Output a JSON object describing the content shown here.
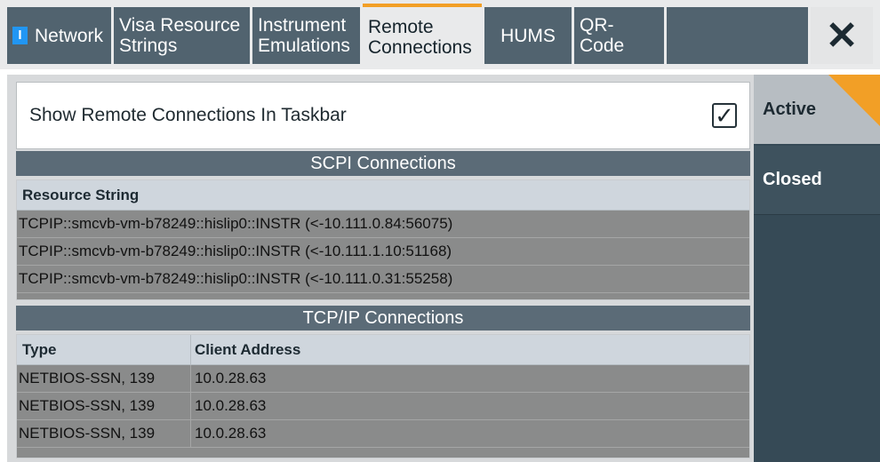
{
  "tabs": [
    {
      "label": "Network",
      "icon": "info-icon"
    },
    {
      "label": "Visa Resource\nStrings"
    },
    {
      "label": "Instrument\nEmulations"
    },
    {
      "label": "Remote\nConnections",
      "active": true
    },
    {
      "label": "HUMS"
    },
    {
      "label": "QR-\nCode"
    }
  ],
  "close_icon": "close-icon",
  "taskbar": {
    "label": "Show Remote Connections In Taskbar",
    "checked": true,
    "check_glyph": "✓"
  },
  "scpi": {
    "title": "SCPI Connections",
    "header": "Resource String",
    "rows": [
      "TCPIP::smcvb-vm-b78249::hislip0::INSTR (<-10.111.0.84:56075)",
      "TCPIP::smcvb-vm-b78249::hislip0::INSTR (<-10.111.1.10:51168)",
      "TCPIP::smcvb-vm-b78249::hislip0::INSTR (<-10.111.0.31:55258)"
    ]
  },
  "tcpip": {
    "title": "TCP/IP Connections",
    "headers": [
      "Type",
      "Client Address"
    ],
    "rows": [
      [
        "NETBIOS-SSN, 139",
        "10.0.28.63"
      ],
      [
        "NETBIOS-SSN, 139",
        "10.0.28.63"
      ],
      [
        "NETBIOS-SSN, 139",
        "10.0.28.63"
      ]
    ]
  },
  "side": {
    "active_label": "Active",
    "closed_label": "Closed"
  },
  "colors": {
    "accent": "#f29f26",
    "tab_bg": "#51636f",
    "side_bg": "#364a56"
  }
}
